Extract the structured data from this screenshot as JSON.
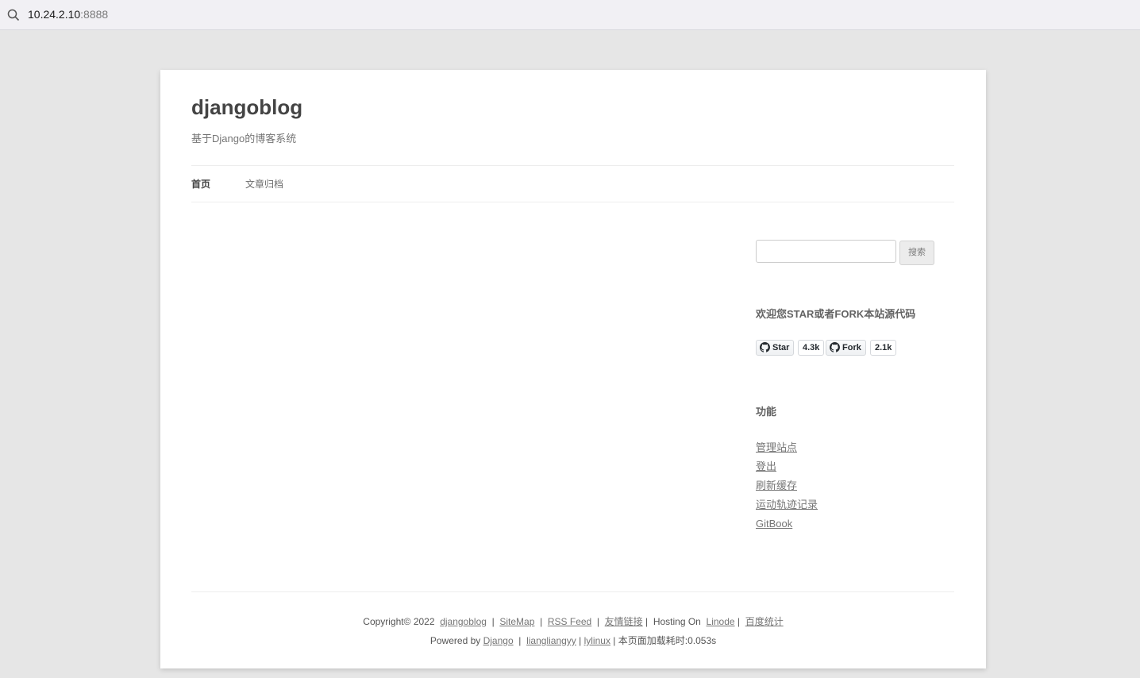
{
  "browser": {
    "url_host": "10.24.2.10",
    "url_port": ":8888"
  },
  "site": {
    "title": "djangoblog",
    "description": "基于Django的博客系统"
  },
  "nav": {
    "home": "首页",
    "archive": "文章归档"
  },
  "search": {
    "button_label": "搜索",
    "value": ""
  },
  "github_widget": {
    "title": "欢迎您STAR或者FORK本站源代码",
    "star_label": "Star",
    "star_count": "4.3k",
    "fork_label": "Fork",
    "fork_count": "2.1k"
  },
  "functions": {
    "title": "功能",
    "links": [
      "管理站点",
      "登出",
      "刷新缓存",
      "运动轨迹记录",
      "GitBook"
    ]
  },
  "footer": {
    "copyright": "Copyright© 2022",
    "site_link": "djangoblog",
    "sitemap": "SiteMap",
    "rss": "RSS Feed",
    "friends": "友情链接",
    "hosting": "Hosting On",
    "linode": "Linode",
    "baidu": "百度统计",
    "powered": "Powered by",
    "django": "Django",
    "author": "liangliangyy",
    "lylinux": "lylinux",
    "load_time": "本页面加载耗时:0.053s"
  },
  "colors": {
    "page_bg": "#e6e6e6",
    "content_bg": "#ffffff",
    "text": "#444444",
    "link": "#757575"
  }
}
